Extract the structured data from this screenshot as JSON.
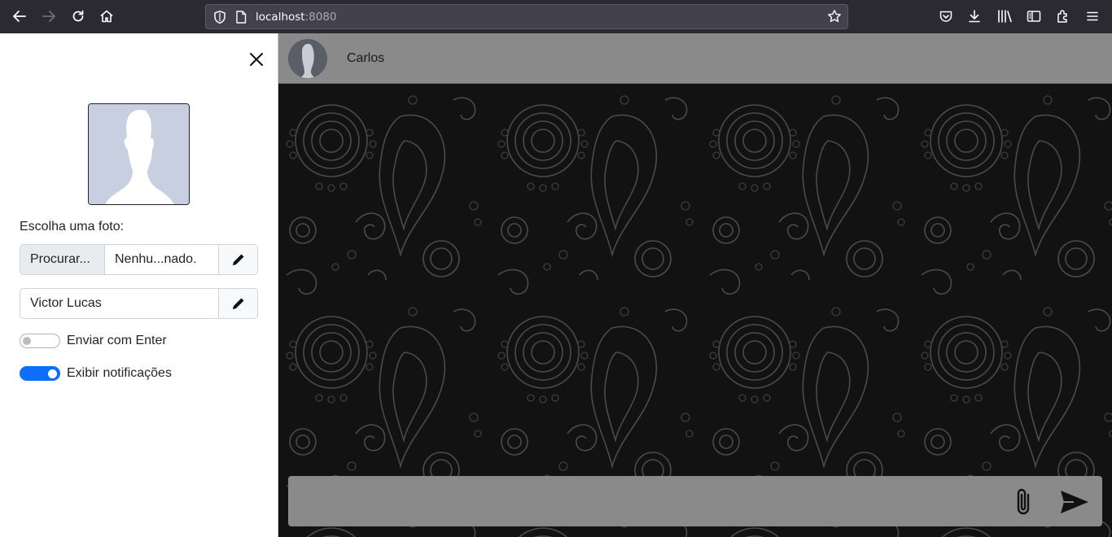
{
  "browser": {
    "url_host": "localhost",
    "url_port": ":8080"
  },
  "sidebar": {
    "photo_label": "Escolha uma foto:",
    "file_browse_label": "Procurar...",
    "file_name": "Nenhu...nado.",
    "name_value": "Victor Lucas",
    "toggles": [
      {
        "label": "Enviar com Enter",
        "checked": false
      },
      {
        "label": "Exibir notificações",
        "checked": true
      }
    ]
  },
  "chat": {
    "contact_name": "Carlos",
    "message_placeholder": ""
  },
  "colors": {
    "accent": "#0d6efd",
    "chrome": "#2b2a33",
    "header": "#8a8a8a",
    "chat_bg": "#131313"
  }
}
